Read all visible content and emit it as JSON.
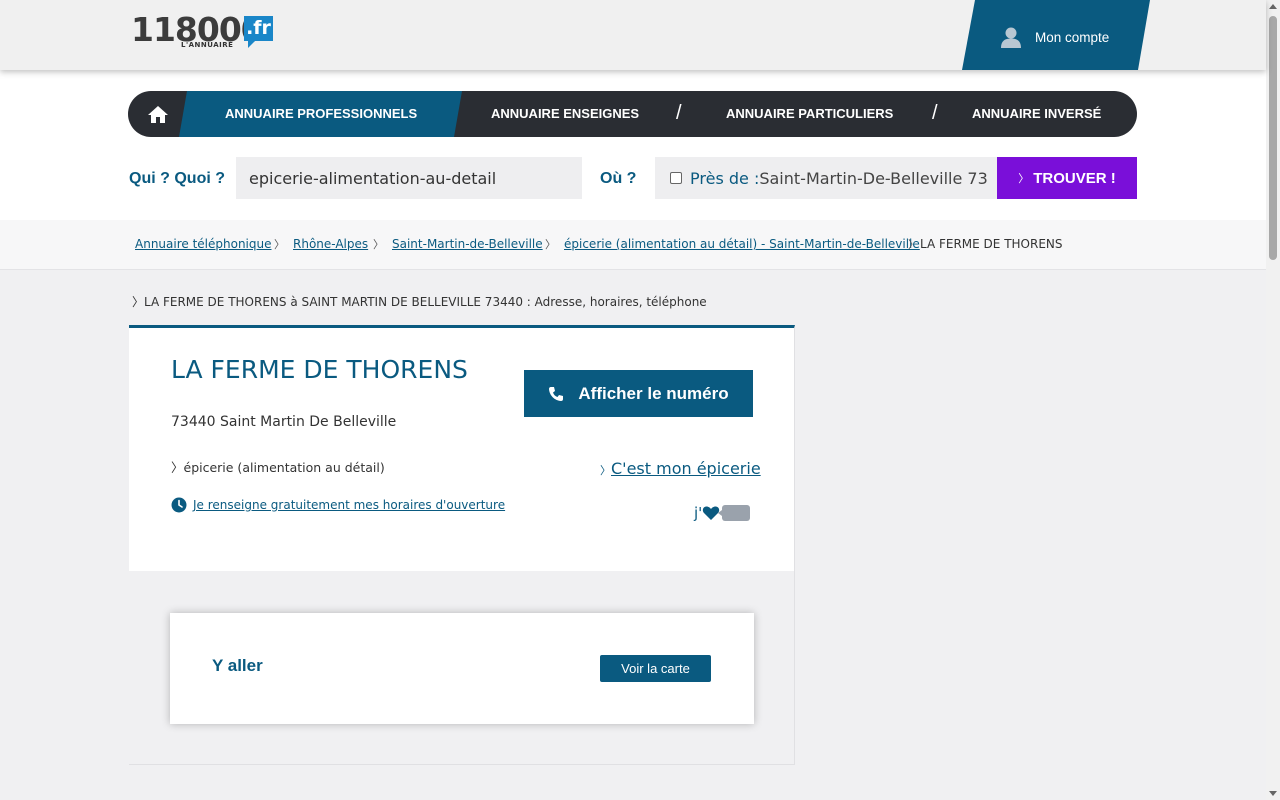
{
  "header": {
    "logo_number": "118000",
    "logo_tld": ".fr",
    "logo_subtitle": "L'ANNUAIRE",
    "account_label": "Mon compte"
  },
  "nav": {
    "items": [
      {
        "label": "ANNUAIRE PROFESSIONNELS",
        "active": true
      },
      {
        "label": "ANNUAIRE ENSEIGNES",
        "active": false
      },
      {
        "label": "ANNUAIRE PARTICULIERS",
        "active": false
      },
      {
        "label": "ANNUAIRE INVERSÉ",
        "active": false
      }
    ],
    "separator": "/"
  },
  "search": {
    "what_label_1": "Qui ?",
    "what_label_2": "Quoi ?",
    "what_value": "epicerie-alimentation-au-detail",
    "where_label": "Où ?",
    "near_label": "Près de :",
    "near_value": "Saint-Martin-De-Belleville 73",
    "find_button": "TROUVER !",
    "find_prefix": "〉"
  },
  "breadcrumb": {
    "links": [
      "Annuaire téléphonique",
      "Rhône-Alpes",
      "Saint-Martin-de-Belleville",
      "épicerie (alimentation au détail) - Saint-Martin-de-Belleville"
    ],
    "current": "LA FERME DE THORENS",
    "separator": "〉"
  },
  "page_heading": "〉LA FERME DE THORENS à SAINT MARTIN DE BELLEVILLE 73440 : Adresse, horaires, téléphone",
  "business": {
    "name": "LA FERME DE THORENS",
    "address": "73440 Saint Martin De Belleville",
    "category": "〉épicerie (alimentation au détail)",
    "hours_link": "Je renseigne gratuitement mes horaires d'ouverture",
    "call_button": "Afficher le numéro",
    "claim_prefix": "〉",
    "claim_link": "C'est mon épicerie",
    "like_label": "j'"
  },
  "directions": {
    "title": "Y aller",
    "map_button": "Voir la carte"
  },
  "colors": {
    "brand_blue": "#0a5a80",
    "nav_dark": "#2a2d33",
    "find_purple": "#7a0fd9"
  }
}
